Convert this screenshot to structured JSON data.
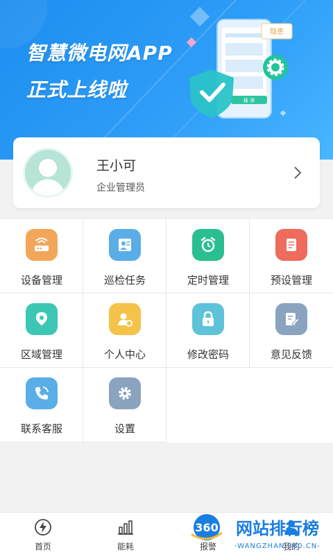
{
  "banner": {
    "line1": "智慧微电网APP",
    "line2": "正式上线啦",
    "phone_button": "操 添",
    "phone_tag": "隐患"
  },
  "profile": {
    "name": "王小可",
    "role": "企业管理员"
  },
  "menu": {
    "items": [
      {
        "label": "设备管理",
        "icon": "router-icon",
        "color": "#f2a65a"
      },
      {
        "label": "巡检任务",
        "icon": "inspection-icon",
        "color": "#5aaee8"
      },
      {
        "label": "定时管理",
        "icon": "alarm-clock-icon",
        "color": "#2bbf8f"
      },
      {
        "label": "预设管理",
        "icon": "clipboard-icon",
        "color": "#ef6b5b"
      },
      {
        "label": "区域管理",
        "icon": "location-icon",
        "color": "#3cc7b5"
      },
      {
        "label": "个人中心",
        "icon": "user-gear-icon",
        "color": "#f5c24a"
      },
      {
        "label": "修改密码",
        "icon": "lock-icon",
        "color": "#5ec3d8"
      },
      {
        "label": "意见反馈",
        "icon": "feedback-icon",
        "color": "#8aa3bf"
      },
      {
        "label": "联系客服",
        "icon": "phone-icon",
        "color": "#5aaee8"
      },
      {
        "label": "设置",
        "icon": "gear-icon",
        "color": "#8aa3bf"
      }
    ]
  },
  "nav": {
    "items": [
      {
        "label": "首页",
        "icon": "lightning-icon"
      },
      {
        "label": "能耗",
        "icon": "bar-chart-icon"
      },
      {
        "label": "报警",
        "icon": "bell-icon"
      },
      {
        "label": "我的",
        "icon": "user-icon"
      }
    ]
  },
  "watermark": {
    "badge": "360",
    "title": "网站排行榜",
    "subtitle": "-WANGZHAN.360.CN-"
  }
}
